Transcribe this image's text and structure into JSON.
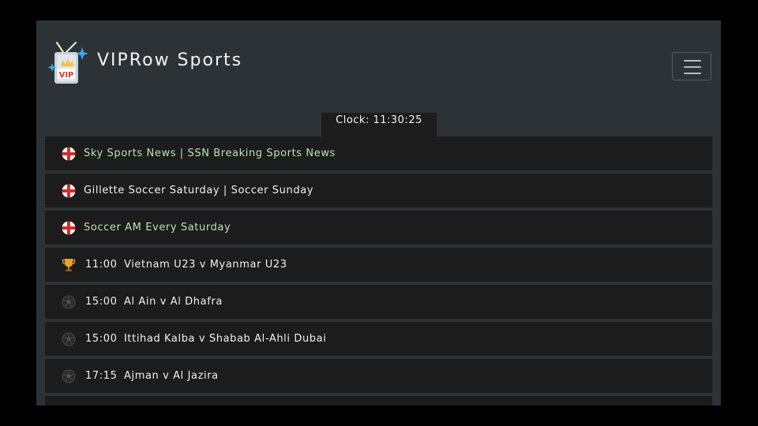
{
  "header": {
    "brand": "VIPRow Sports",
    "logo_badge": "VIP",
    "menu_icon": "hamburger-menu-icon"
  },
  "clock": {
    "text": "Clock: 11:30:25"
  },
  "colors": {
    "page_bg": "#000000",
    "panel_bg": "#2d3237",
    "row_bg": "#1c1c1c",
    "link_green": "#b9e3b0",
    "link_white": "#f0f0f0"
  },
  "channels": [
    {
      "icon": "england-flag-icon",
      "label": "Sky Sports News | SSN Breaking Sports News",
      "color": "#b9e3b0"
    },
    {
      "icon": "england-flag-icon",
      "label": "Gillette Soccer Saturday | Soccer Sunday",
      "color": "#f0f0f0"
    },
    {
      "icon": "england-flag-icon",
      "label": "Soccer AM Every Saturday",
      "color": "#b9e3b0"
    }
  ],
  "events": [
    {
      "icon": "trophy-icon",
      "time": "11:00",
      "match": "Vietnam U23 v Myanmar U23"
    },
    {
      "icon": "soccer-ball-icon",
      "time": "15:00",
      "match": "Al Ain v Al Dhafra"
    },
    {
      "icon": "soccer-ball-icon",
      "time": "15:00",
      "match": "Ittihad Kalba v Shabab Al-Ahli Dubai"
    },
    {
      "icon": "soccer-ball-icon",
      "time": "17:15",
      "match": "Ajman v Al Jazira"
    }
  ]
}
